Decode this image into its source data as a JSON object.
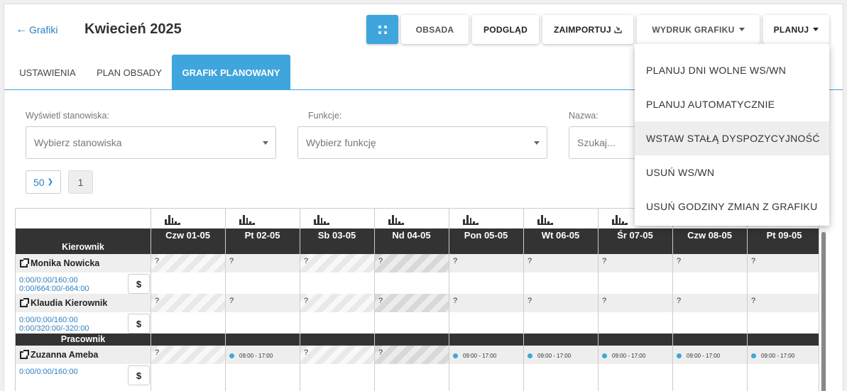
{
  "header": {
    "back_label": "Grafiki",
    "month_title": "Kwiecień 2025"
  },
  "toolbar": {
    "obsada_label": "OBSADA",
    "podglad_label": "PODGLĄD",
    "import_label": "ZAIMPORTUJ",
    "wydruk_label": "WYDRUK GRAFIKU",
    "planuj_label": "PLANUJ"
  },
  "tabs": [
    {
      "label": "USTAWIENIA"
    },
    {
      "label": "PLAN OBSADY"
    },
    {
      "label": "GRAFIK PLANOWANY",
      "active": true
    }
  ],
  "filters": {
    "positions": {
      "label": "Wyświetl stanowiska:",
      "placeholder": "Wybierz stanowiska"
    },
    "functions": {
      "label": "Funkcje:",
      "placeholder": "Wybierz funkcję"
    },
    "name": {
      "label": "Nazwa:",
      "placeholder": "Szukaj..."
    }
  },
  "pagination": {
    "per_page": "50",
    "page": "1"
  },
  "schedule": {
    "days": [
      "Czw 01-05",
      "Pt 02-05",
      "Sb 03-05",
      "Nd 04-05",
      "Pon 05-05",
      "Wt 06-05",
      "Śr 07-05",
      "Czw 08-05",
      "Pt 09-05"
    ],
    "groups": [
      {
        "name": "Kierownik",
        "employees": [
          {
            "name": "Monika Nowicka",
            "stats1": "0:00/0:00/160:00",
            "stats2": "0:00/664:00/-664:00",
            "cells": [
              "?",
              "?",
              "?",
              "?",
              "?",
              "?",
              "?",
              "?",
              "?"
            ]
          },
          {
            "name": "Klaudia Kierownik",
            "stats1": "0:00/0:00/160:00",
            "stats2": "0:00/320:00/-320:00",
            "cells": [
              "?",
              "?",
              "?",
              "?",
              "?",
              "?",
              "?",
              "?",
              "?"
            ]
          }
        ]
      },
      {
        "name": "Pracownik",
        "employees": [
          {
            "name": "Zuzanna Ameba",
            "stats1": "0:00/0:00/160:00",
            "stats2": "",
            "cells": [
              "?",
              "09:00 - 17:00",
              "?",
              "?",
              "09:00 - 17:00",
              "09:00 - 17:00",
              "09:00 - 17:00",
              "09:00 - 17:00",
              "09:00 - 17:00"
            ]
          }
        ]
      }
    ],
    "currency_symbol": "$"
  },
  "planuj_menu": [
    {
      "label": "PLANUJ DNI WOLNE WS/WN"
    },
    {
      "label": "PLANUJ AUTOMATYCZNIE"
    },
    {
      "label": "WSTAW STAŁĄ DYSPOZYCYJNOŚĆ",
      "hover": true
    },
    {
      "label": "USUŃ WS/WN"
    },
    {
      "label": "USUŃ GODZINY ZMIAN Z GRAFIKU"
    }
  ],
  "colors": {
    "accent": "#3fa5dd",
    "link": "#2c7fc0",
    "dark_band": "#333333"
  }
}
